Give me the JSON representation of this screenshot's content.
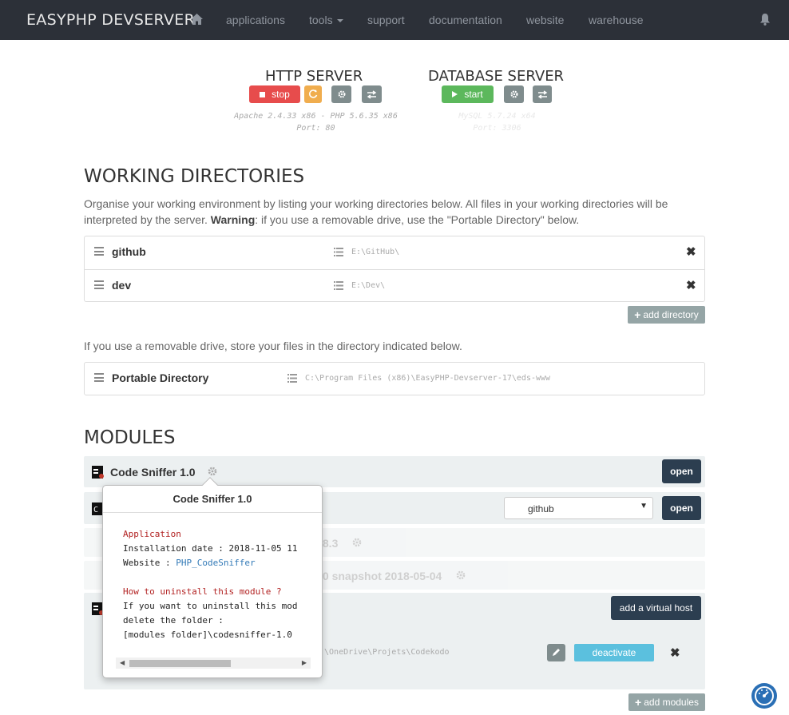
{
  "navbar": {
    "brand": "EASYPHP DEVSERVER",
    "items": [
      "applications",
      "tools",
      "support",
      "documentation",
      "website",
      "warehouse"
    ]
  },
  "http_server": {
    "title": "HTTP SERVER",
    "stop_label": "stop",
    "info_line1": "Apache 2.4.33 x86 - PHP 5.6.35 x86",
    "info_line2": "Port: 80"
  },
  "database_server": {
    "title": "DATABASE SERVER",
    "start_label": "start",
    "info_line1": "MySQL 5.7.24 x64",
    "info_line2": "Port: 3306"
  },
  "working_directories": {
    "title": "WORKING DIRECTORIES",
    "intro_part1": "Organise your working environment by listing your working directories below. All files in your working directories will be interpreted by the server. ",
    "intro_bold": "Warning",
    "intro_part2": ": if you use a removable drive, use the \"Portable Directory\" below.",
    "items": [
      {
        "name": "github",
        "path": "E:\\GitHub\\"
      },
      {
        "name": "dev",
        "path": "E:\\Dev\\"
      }
    ],
    "add_label": "add directory",
    "portable_note": "If you use a removable drive, store your files in the directory indicated below.",
    "portable_name": "Portable Directory",
    "portable_path": "C:\\Program Files (x86)\\EasyPHP-Devserver-17\\eds-www"
  },
  "modules": {
    "title": "MODULES",
    "module1_name": "Code Sniffer 1.0",
    "open_label": "open",
    "select_value": "github",
    "module3_name_tail": ".8.3",
    "module4_name_tail": ".0 snapshot 2018-05-04",
    "add_vhost_label": "add a virtual host",
    "vhost_path_tail": ":\\OneDrive\\Projets\\Codekodo",
    "deactivate_label": "deactivate",
    "add_modules_label": "add modules",
    "popover": {
      "title": "Code Sniffer 1.0",
      "application_heading": "Application",
      "installation_line": "Installation date : 2018-11-05 11",
      "website_prefix": "Website : ",
      "website_link": "PHP_CodeSniffer",
      "uninstall_heading": "How to uninstall this module ?",
      "uninstall_line1": "If you want to uninstall this mod",
      "uninstall_line2": "delete the folder :",
      "uninstall_line3": "[modules folder]\\codesniffer-1.0"
    }
  },
  "colors": {
    "navbar_bg": "#2c3038",
    "stop_red": "#e74c4c",
    "start_green": "#5cb85c",
    "dark_button": "#2c3e50",
    "deactivate_blue": "#5bc0de"
  }
}
